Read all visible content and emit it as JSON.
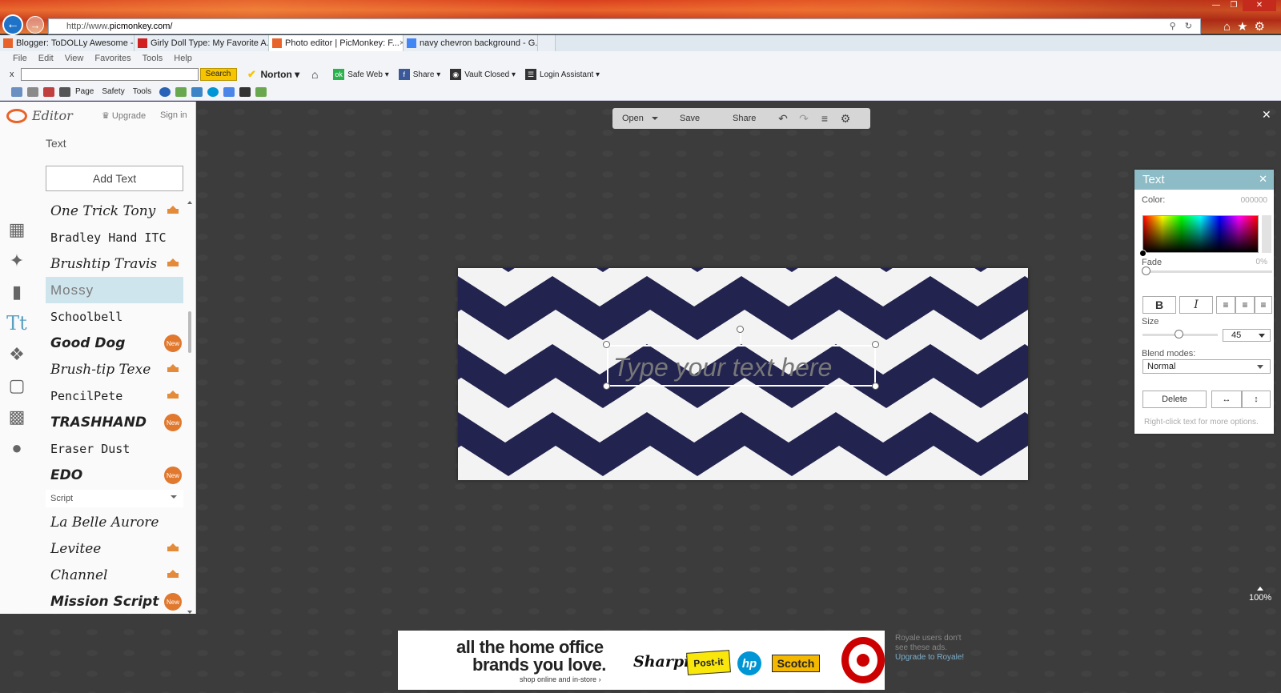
{
  "browser": {
    "url_prefix": "http://www.",
    "url_host": "picmonkey.com/",
    "tabs": [
      {
        "label": "Blogger: ToDOLLy Awesome - ...",
        "fav_color": "#e8632a"
      },
      {
        "label": "Girly Doll Type: My Favorite A...",
        "fav_color": "#d02020"
      },
      {
        "label": "Photo editor | PicMonkey: F...",
        "fav_color": "#e8632a",
        "active": true
      },
      {
        "label": "navy chevron background - G...",
        "fav_color": "#4285f4"
      }
    ],
    "menu": [
      "File",
      "Edit",
      "View",
      "Favorites",
      "Tools",
      "Help"
    ],
    "toolbar1": {
      "x": "x",
      "search_btn": "Search",
      "norton": "Norton",
      "safe_web": "Safe Web",
      "share": "Share",
      "vault": "Vault Closed",
      "login": "Login Assistant"
    },
    "toolbar2": {
      "page": "Page",
      "safety": "Safety",
      "tools": "Tools"
    }
  },
  "app": {
    "logo_word": "Editor",
    "upgrade": "Upgrade",
    "signin": "Sign in",
    "panel_title": "Text",
    "add_text": "Add Text",
    "fonts": [
      {
        "name": "One Trick Tony",
        "badge": "crown",
        "style": "f-script"
      },
      {
        "name": "Bradley Hand ITC",
        "badge": "",
        "style": "f-hand"
      },
      {
        "name": "Brushtip Travis",
        "badge": "crown",
        "style": "f-script"
      },
      {
        "name": "Mossy",
        "badge": "",
        "style": "f-thin",
        "selected": true
      },
      {
        "name": "Schoolbell",
        "badge": "",
        "style": "f-hand"
      },
      {
        "name": "Good Dog",
        "badge": "new",
        "style": "f-bold"
      },
      {
        "name": "Brush-tip Texe",
        "badge": "crown",
        "style": "f-script"
      },
      {
        "name": "PencilPete",
        "badge": "crown",
        "style": "f-hand"
      },
      {
        "name": "TRASHHAND",
        "badge": "new",
        "style": "f-bold"
      },
      {
        "name": "Eraser Dust",
        "badge": "",
        "style": "f-hand"
      },
      {
        "name": "EDO",
        "badge": "new",
        "style": "f-bold"
      }
    ],
    "category": "Script",
    "script_fonts": [
      {
        "name": "La Belle Aurore",
        "badge": "",
        "style": "f-script"
      },
      {
        "name": "Levitee",
        "badge": "crown",
        "style": "f-script"
      },
      {
        "name": "Channel",
        "badge": "crown",
        "style": "f-script"
      },
      {
        "name": "Mission Script",
        "badge": "new",
        "style": "f-bold"
      }
    ],
    "new_badge": "New",
    "topbar": {
      "open": "Open",
      "save": "Save",
      "share": "Share"
    },
    "canvas_text": "Type your text here",
    "chevron_color": "#23234f",
    "text_panel": {
      "title": "Text",
      "color_label": "Color:",
      "color_value": "000000",
      "fade_label": "Fade",
      "fade_value": "0%",
      "size_label": "Size",
      "size_value": "45",
      "blend_label": "Blend modes:",
      "blend_value": "Normal",
      "delete": "Delete",
      "hint": "Right-click text for more options."
    },
    "zoom": "100%"
  },
  "ad": {
    "line1": "all the home office",
    "line2": "brands you love.",
    "line3": "shop online and in-store ›",
    "sharpie": "Sharpie.",
    "postit": "Post-it",
    "hp": "hp",
    "scotch": "Scotch",
    "royale_line1": "Royale users don't",
    "royale_line2": "see these ads.",
    "royale_link": "Upgrade to Royale!"
  }
}
